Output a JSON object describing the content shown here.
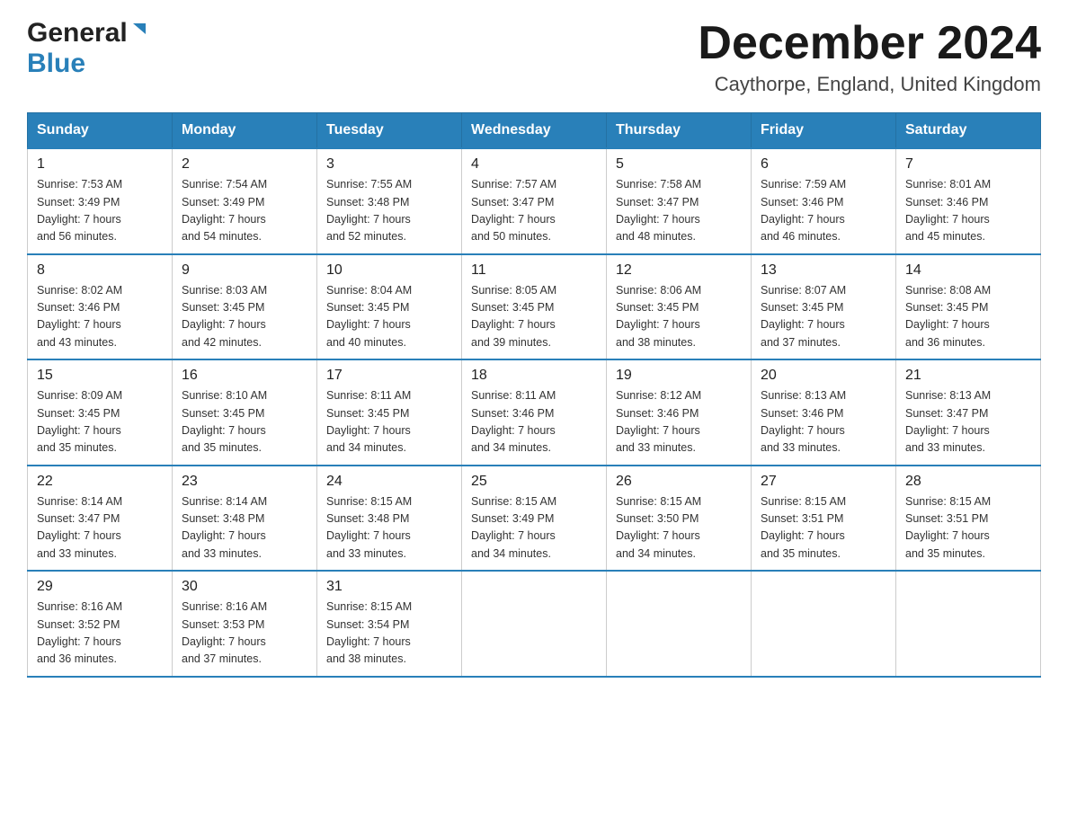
{
  "header": {
    "logo_general": "General",
    "logo_blue": "Blue",
    "month_title": "December 2024",
    "location": "Caythorpe, England, United Kingdom"
  },
  "weekdays": [
    "Sunday",
    "Monday",
    "Tuesday",
    "Wednesday",
    "Thursday",
    "Friday",
    "Saturday"
  ],
  "weeks": [
    [
      {
        "day": "1",
        "sunrise": "7:53 AM",
        "sunset": "3:49 PM",
        "daylight": "7 hours and 56 minutes."
      },
      {
        "day": "2",
        "sunrise": "7:54 AM",
        "sunset": "3:49 PM",
        "daylight": "7 hours and 54 minutes."
      },
      {
        "day": "3",
        "sunrise": "7:55 AM",
        "sunset": "3:48 PM",
        "daylight": "7 hours and 52 minutes."
      },
      {
        "day": "4",
        "sunrise": "7:57 AM",
        "sunset": "3:47 PM",
        "daylight": "7 hours and 50 minutes."
      },
      {
        "day": "5",
        "sunrise": "7:58 AM",
        "sunset": "3:47 PM",
        "daylight": "7 hours and 48 minutes."
      },
      {
        "day": "6",
        "sunrise": "7:59 AM",
        "sunset": "3:46 PM",
        "daylight": "7 hours and 46 minutes."
      },
      {
        "day": "7",
        "sunrise": "8:01 AM",
        "sunset": "3:46 PM",
        "daylight": "7 hours and 45 minutes."
      }
    ],
    [
      {
        "day": "8",
        "sunrise": "8:02 AM",
        "sunset": "3:46 PM",
        "daylight": "7 hours and 43 minutes."
      },
      {
        "day": "9",
        "sunrise": "8:03 AM",
        "sunset": "3:45 PM",
        "daylight": "7 hours and 42 minutes."
      },
      {
        "day": "10",
        "sunrise": "8:04 AM",
        "sunset": "3:45 PM",
        "daylight": "7 hours and 40 minutes."
      },
      {
        "day": "11",
        "sunrise": "8:05 AM",
        "sunset": "3:45 PM",
        "daylight": "7 hours and 39 minutes."
      },
      {
        "day": "12",
        "sunrise": "8:06 AM",
        "sunset": "3:45 PM",
        "daylight": "7 hours and 38 minutes."
      },
      {
        "day": "13",
        "sunrise": "8:07 AM",
        "sunset": "3:45 PM",
        "daylight": "7 hours and 37 minutes."
      },
      {
        "day": "14",
        "sunrise": "8:08 AM",
        "sunset": "3:45 PM",
        "daylight": "7 hours and 36 minutes."
      }
    ],
    [
      {
        "day": "15",
        "sunrise": "8:09 AM",
        "sunset": "3:45 PM",
        "daylight": "7 hours and 35 minutes."
      },
      {
        "day": "16",
        "sunrise": "8:10 AM",
        "sunset": "3:45 PM",
        "daylight": "7 hours and 35 minutes."
      },
      {
        "day": "17",
        "sunrise": "8:11 AM",
        "sunset": "3:45 PM",
        "daylight": "7 hours and 34 minutes."
      },
      {
        "day": "18",
        "sunrise": "8:11 AM",
        "sunset": "3:46 PM",
        "daylight": "7 hours and 34 minutes."
      },
      {
        "day": "19",
        "sunrise": "8:12 AM",
        "sunset": "3:46 PM",
        "daylight": "7 hours and 33 minutes."
      },
      {
        "day": "20",
        "sunrise": "8:13 AM",
        "sunset": "3:46 PM",
        "daylight": "7 hours and 33 minutes."
      },
      {
        "day": "21",
        "sunrise": "8:13 AM",
        "sunset": "3:47 PM",
        "daylight": "7 hours and 33 minutes."
      }
    ],
    [
      {
        "day": "22",
        "sunrise": "8:14 AM",
        "sunset": "3:47 PM",
        "daylight": "7 hours and 33 minutes."
      },
      {
        "day": "23",
        "sunrise": "8:14 AM",
        "sunset": "3:48 PM",
        "daylight": "7 hours and 33 minutes."
      },
      {
        "day": "24",
        "sunrise": "8:15 AM",
        "sunset": "3:48 PM",
        "daylight": "7 hours and 33 minutes."
      },
      {
        "day": "25",
        "sunrise": "8:15 AM",
        "sunset": "3:49 PM",
        "daylight": "7 hours and 34 minutes."
      },
      {
        "day": "26",
        "sunrise": "8:15 AM",
        "sunset": "3:50 PM",
        "daylight": "7 hours and 34 minutes."
      },
      {
        "day": "27",
        "sunrise": "8:15 AM",
        "sunset": "3:51 PM",
        "daylight": "7 hours and 35 minutes."
      },
      {
        "day": "28",
        "sunrise": "8:15 AM",
        "sunset": "3:51 PM",
        "daylight": "7 hours and 35 minutes."
      }
    ],
    [
      {
        "day": "29",
        "sunrise": "8:16 AM",
        "sunset": "3:52 PM",
        "daylight": "7 hours and 36 minutes."
      },
      {
        "day": "30",
        "sunrise": "8:16 AM",
        "sunset": "3:53 PM",
        "daylight": "7 hours and 37 minutes."
      },
      {
        "day": "31",
        "sunrise": "8:15 AM",
        "sunset": "3:54 PM",
        "daylight": "7 hours and 38 minutes."
      },
      null,
      null,
      null,
      null
    ]
  ],
  "labels": {
    "sunrise": "Sunrise: ",
    "sunset": "Sunset: ",
    "daylight": "Daylight: "
  }
}
